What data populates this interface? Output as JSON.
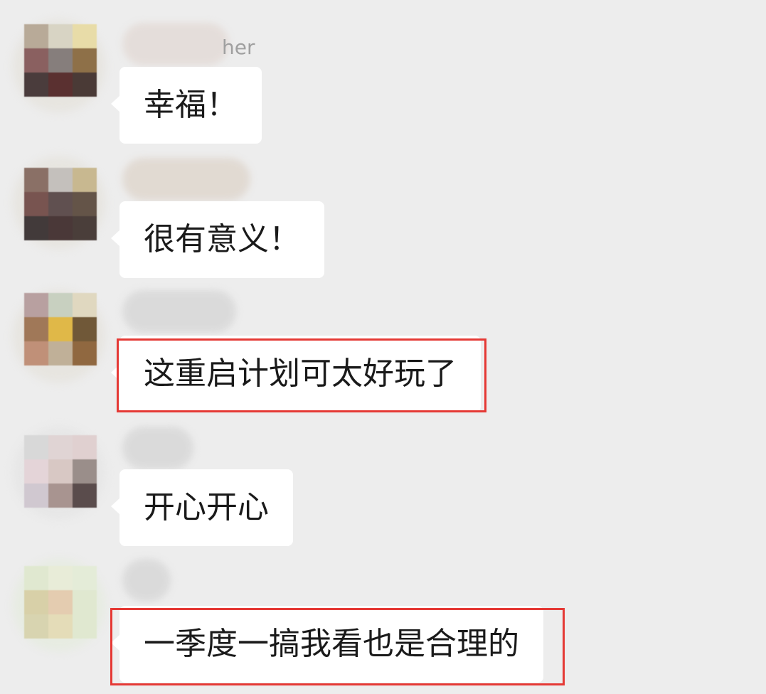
{
  "messages": [
    {
      "sender": "",
      "sender_suffix": "her",
      "text": "幸福！",
      "highlighted": false,
      "avatar_colors": [
        "#b8aa98",
        "#d8d4c4",
        "#e8dca8",
        "#8a6060",
        "#867e7c",
        "#8e7048",
        "#4a3c3c",
        "#5a3030",
        "#4a3a36"
      ]
    },
    {
      "sender": "",
      "sender_suffix": "",
      "text": "很有意义！",
      "highlighted": false,
      "avatar_colors": [
        "#8a7066",
        "#c4c0bc",
        "#c8b890",
        "#785450",
        "#605050",
        "#645448",
        "#423a3a",
        "#4a3838",
        "#4a3e3a"
      ]
    },
    {
      "sender": "",
      "sender_suffix": "",
      "text": "这重启计划可太好玩了",
      "highlighted": true,
      "avatar_colors": [
        "#b8a0a0",
        "#c8d0c0",
        "#e0d8c0",
        "#a07858",
        "#e0b848",
        "#705838",
        "#c09078",
        "#c0b098",
        "#906840"
      ]
    },
    {
      "sender": "",
      "sender_suffix": "",
      "text": "开心开心",
      "highlighted": false,
      "avatar_colors": [
        "#d8d8d8",
        "#e0d4d4",
        "#e0d0d0",
        "#e4d4d8",
        "#d8c8c4",
        "#9a8e8a",
        "#d0c8d0",
        "#a89490",
        "#5a4c4c"
      ]
    },
    {
      "sender": "",
      "sender_suffix": "",
      "text": "一季度一搞我看也是合理的",
      "highlighted": true,
      "avatar_colors": [
        "#e0e8d0",
        "#e8ecd8",
        "#e4ecd8",
        "#d8d0a8",
        "#e4ccb0",
        "#e0e8d0",
        "#d8d4b0",
        "#e4dcb8",
        "#e0e8d0"
      ]
    }
  ]
}
